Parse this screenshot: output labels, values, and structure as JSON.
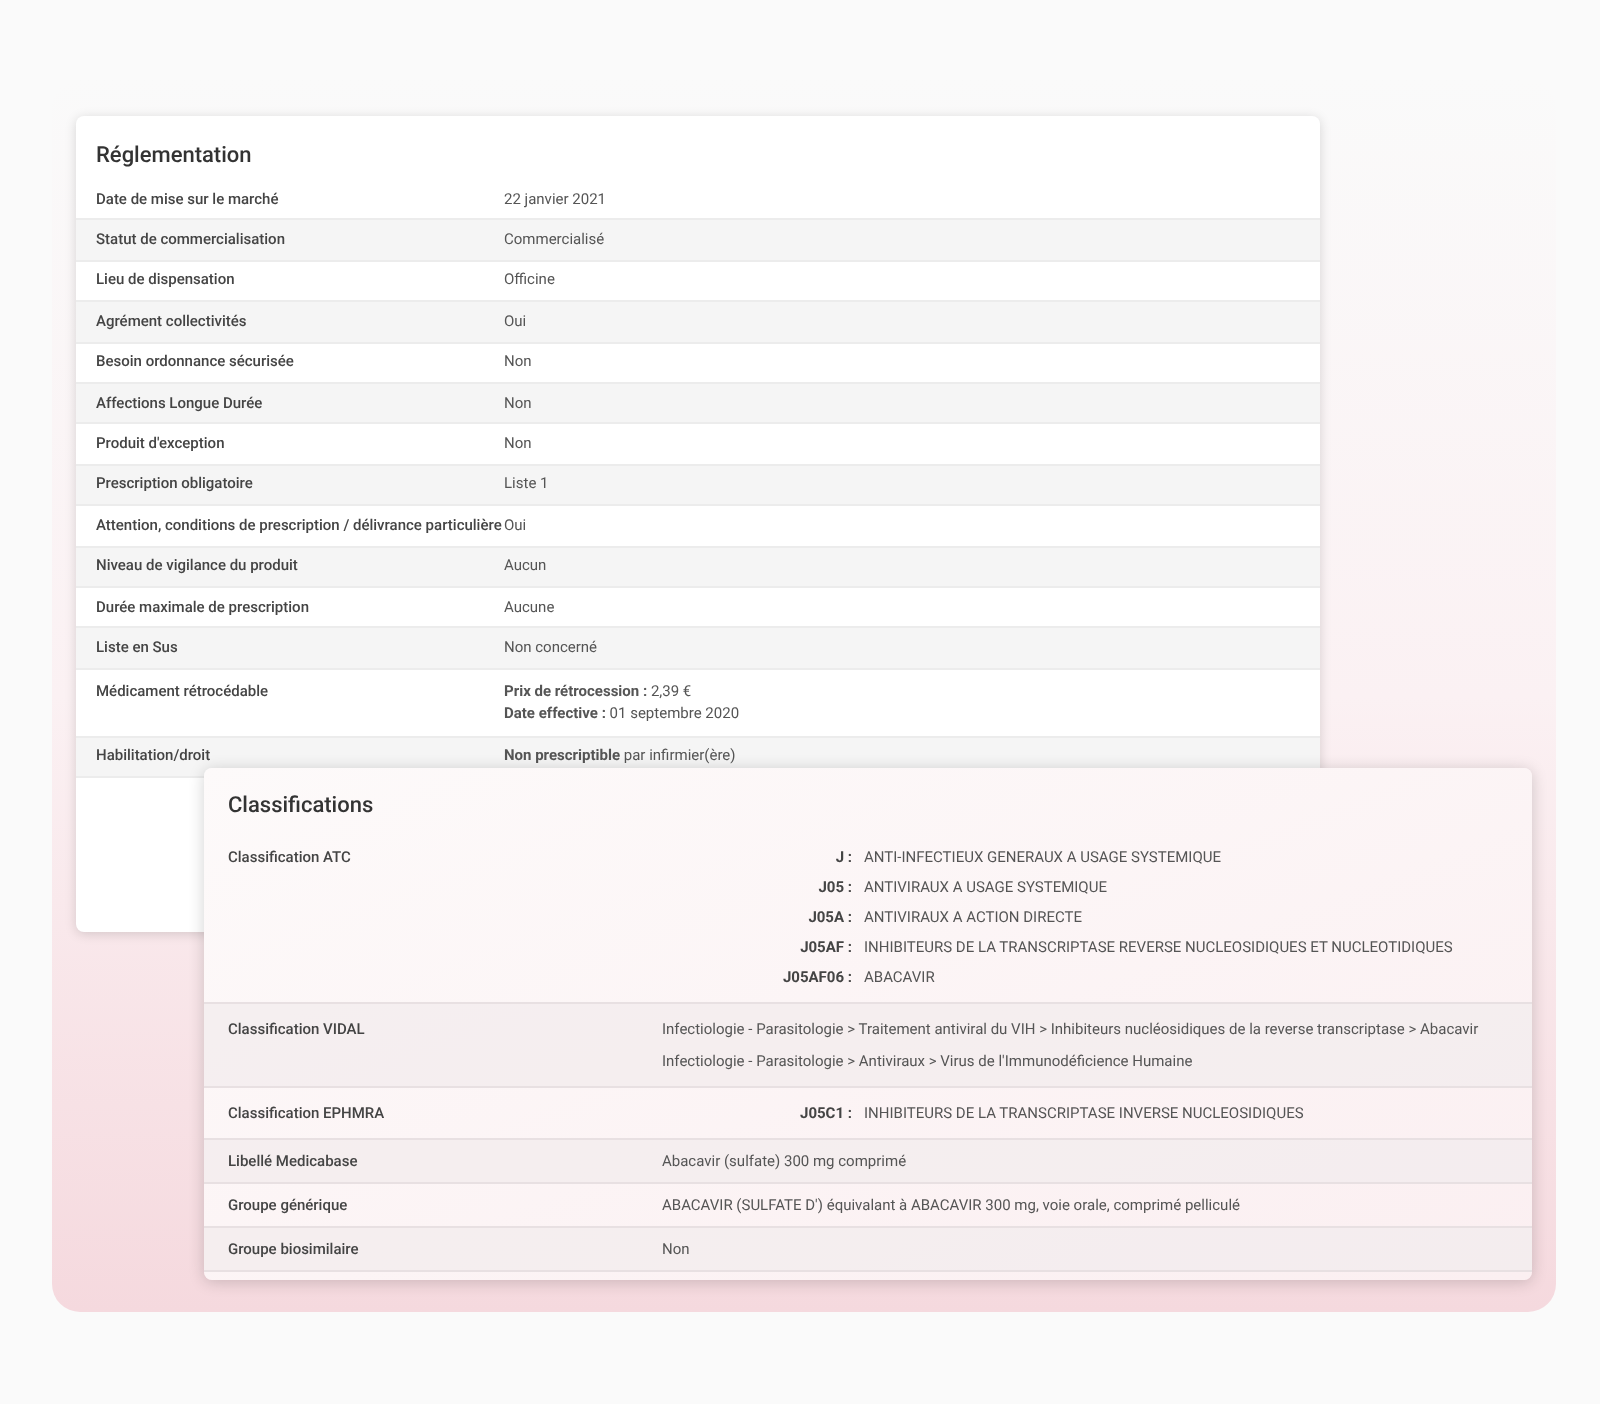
{
  "reglementation": {
    "title": "Réglementation",
    "rows": [
      {
        "label": "Date de mise sur le marché",
        "lines": [
          "22 janvier 2021"
        ]
      },
      {
        "label": "Statut de commercialisation",
        "lines": [
          "Commercialisé"
        ]
      },
      {
        "label": "Lieu de dispensation",
        "lines": [
          "Officine"
        ]
      },
      {
        "label": "Agrément collectivités",
        "lines": [
          "Oui"
        ]
      },
      {
        "label": "Besoin ordonnance sécurisée",
        "lines": [
          "Non"
        ]
      },
      {
        "label": "Affections Longue Durée",
        "lines": [
          "Non"
        ]
      },
      {
        "label": "Produit d'exception",
        "lines": [
          "Non"
        ]
      },
      {
        "label": "Prescription obligatoire",
        "lines": [
          "Liste 1"
        ]
      },
      {
        "label": "Attention, conditions de prescription / délivrance particulière",
        "lines": [
          "Oui"
        ]
      },
      {
        "label": "Niveau de vigilance du produit",
        "lines": [
          "Aucun"
        ]
      },
      {
        "label": "Durée maximale de prescription",
        "lines": [
          "Aucune"
        ]
      },
      {
        "label": "Liste en Sus",
        "lines": [
          "Non concerné"
        ]
      },
      {
        "label": "Médicament rétrocédable",
        "lines": [
          "**Prix de rétrocession :** 2,39 €",
          "**Date effective :** 01 septembre 2020"
        ]
      },
      {
        "label": "Habilitation/droit",
        "lines": [
          "**Non prescriptible** par infirmier(ère)"
        ]
      }
    ]
  },
  "classifications": {
    "title": "Classifications",
    "rows": [
      {
        "label": "Classification ATC",
        "kind": "codes",
        "entries": [
          {
            "code": "J :",
            "text": "ANTI-INFECTIEUX GENERAUX A USAGE SYSTEMIQUE"
          },
          {
            "code": "J05 :",
            "text": "ANTIVIRAUX A USAGE SYSTEMIQUE"
          },
          {
            "code": "J05A :",
            "text": "ANTIVIRAUX A ACTION DIRECTE"
          },
          {
            "code": "J05AF :",
            "text": "INHIBITEURS DE LA TRANSCRIPTASE REVERSE NUCLEOSIDIQUES ET NUCLEOTIDIQUES"
          },
          {
            "code": "J05AF06 :",
            "text": "ABACAVIR"
          }
        ]
      },
      {
        "label": "Classification VIDAL",
        "kind": "lines",
        "lines": [
          "Infectiologie - Parasitologie > Traitement antiviral du VIH > Inhibiteurs nucléosidiques de la reverse transcriptase > Abacavir",
          "Infectiologie - Parasitologie > Antiviraux > Virus de l'Immunodéficience Humaine"
        ]
      },
      {
        "label": "Classification EPHMRA",
        "kind": "codes",
        "entries": [
          {
            "code": "J05C1 :",
            "text": "INHIBITEURS DE LA TRANSCRIPTASE INVERSE NUCLEOSIDIQUES"
          }
        ]
      },
      {
        "label": "Libellé Medicabase",
        "kind": "lines",
        "lines": [
          "Abacavir (sulfate) 300 mg comprimé"
        ]
      },
      {
        "label": "Groupe générique",
        "kind": "lines",
        "lines": [
          "ABACAVIR (SULFATE D') équivalant à ABACAVIR 300 mg, voie orale, comprimé pelliculé"
        ]
      },
      {
        "label": "Groupe biosimilaire",
        "kind": "lines",
        "lines": [
          "Non"
        ]
      }
    ]
  }
}
